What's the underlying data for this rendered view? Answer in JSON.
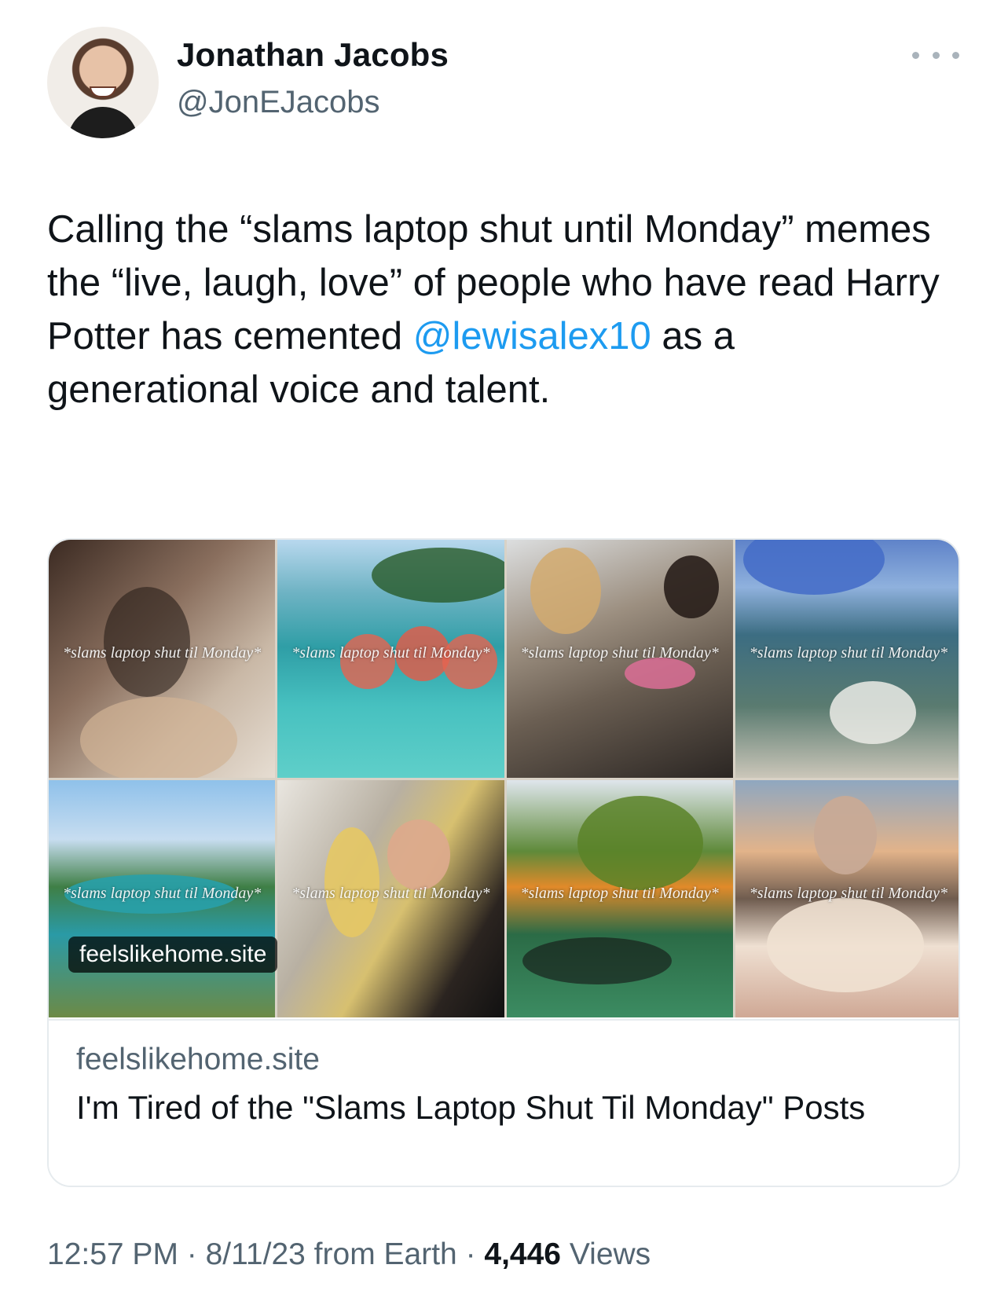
{
  "author": {
    "name": "Jonathan Jacobs",
    "handle": "@JonEJacobs"
  },
  "tweet": {
    "text_part1": "Calling the “slams laptop shut until Monday” memes the “live, laugh, love” of people who have read Harry Potter has cemented ",
    "mention": "@lewisalex10",
    "text_part2": " as a generational voice and talent."
  },
  "card": {
    "image_captions": [
      "*slams laptop shut til Monday*",
      "*slams laptop shut til Monday*",
      "*slams laptop shut til Monday*",
      "*slams laptop shut til Monday*",
      "*slams laptop shut til Monday*",
      "*slams laptop shut til Monday*",
      "*slams laptop shut til Monday*",
      "*slams laptop shut til Monday*"
    ],
    "image_domain_pill": "feelslikehome.site",
    "domain": "feelslikehome.site",
    "title": "I'm Tired of the \"Slams Laptop Shut Til Monday\" Posts"
  },
  "footer": {
    "time": "12:57 PM",
    "separator1": " · ",
    "date": "8/11/23",
    "source": " from Earth",
    "separator2": " · ",
    "views_count": "4,446",
    "views_label": " Views"
  },
  "colors": {
    "accent": "#1d9bf0",
    "secondary_text": "#536471",
    "primary_text": "#0f1419"
  },
  "icons": {
    "more": "more-horizontal-icon"
  }
}
